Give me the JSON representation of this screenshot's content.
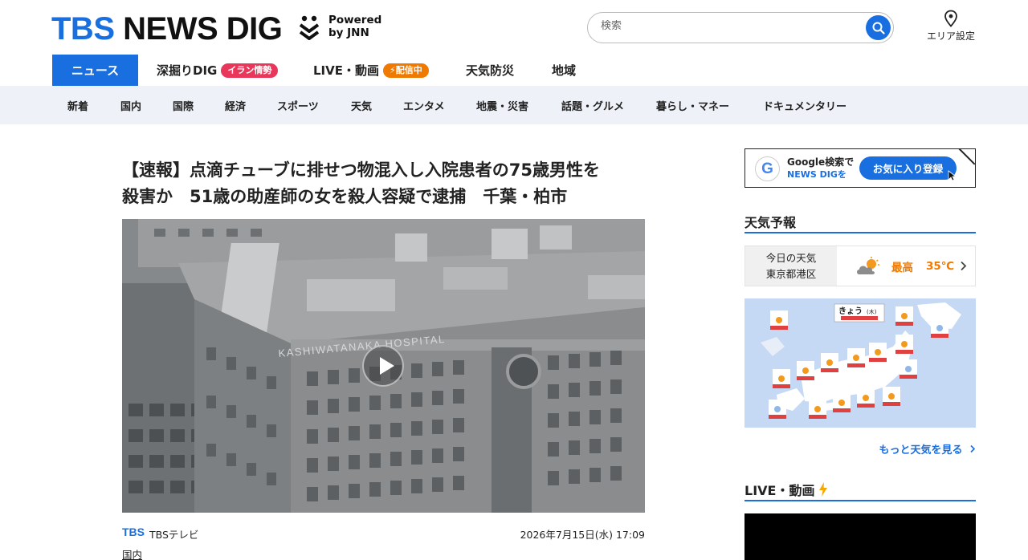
{
  "header": {
    "logo_tbs": "TBS",
    "logo_rest": "NEWS DIG",
    "powered_line1": "Powered",
    "powered_line2": "by JNN",
    "search_placeholder": "検索",
    "area_label": "エリア設定"
  },
  "nav_primary": [
    {
      "label": "ニュース",
      "active": true
    },
    {
      "label": "深掘りDIG",
      "badge": "イラン情勢"
    },
    {
      "label": "LIVE・動画",
      "badge": "⚡配信中"
    },
    {
      "label": "天気防災"
    },
    {
      "label": "地域"
    }
  ],
  "nav_secondary": [
    "新着",
    "国内",
    "国際",
    "経済",
    "スポーツ",
    "天気",
    "エンタメ",
    "地震・災害",
    "話題・グルメ",
    "暮らし・マネー",
    "ドキュメンタリー"
  ],
  "article": {
    "headline_line1": "【速報】点滴チューブに排せつ物混入し入院患者の75歳男性を",
    "headline_line2": "殺害か　51歳の助産師の女を殺人容疑で逮捕　千葉・柏市",
    "building_sign": "KASHIWATANAKA HOSPITAL",
    "source_logo": "TBS",
    "source_name": "TBSテレビ",
    "date": "2026年7月15日(水) 17:09",
    "category": "国内"
  },
  "sidebar": {
    "google_line1": "Google検索で",
    "google_line2": "NEWS DIGを",
    "favorite_button": "お気に入り登録",
    "weather_title": "天気予報",
    "weather_today": "今日の天気",
    "weather_location": "東京都港区",
    "weather_high_label": "最高",
    "weather_high_temp": "35℃",
    "map_title": "きょう",
    "map_day": "(木)",
    "more_weather": "もっと天気を見る",
    "live_title": "LIVE・動画"
  },
  "colors": {
    "brand_blue": "#1a6fe0",
    "badge_red": "#e8375a",
    "badge_orange": "#f07a00",
    "nav2_bg": "#eef2f8"
  }
}
